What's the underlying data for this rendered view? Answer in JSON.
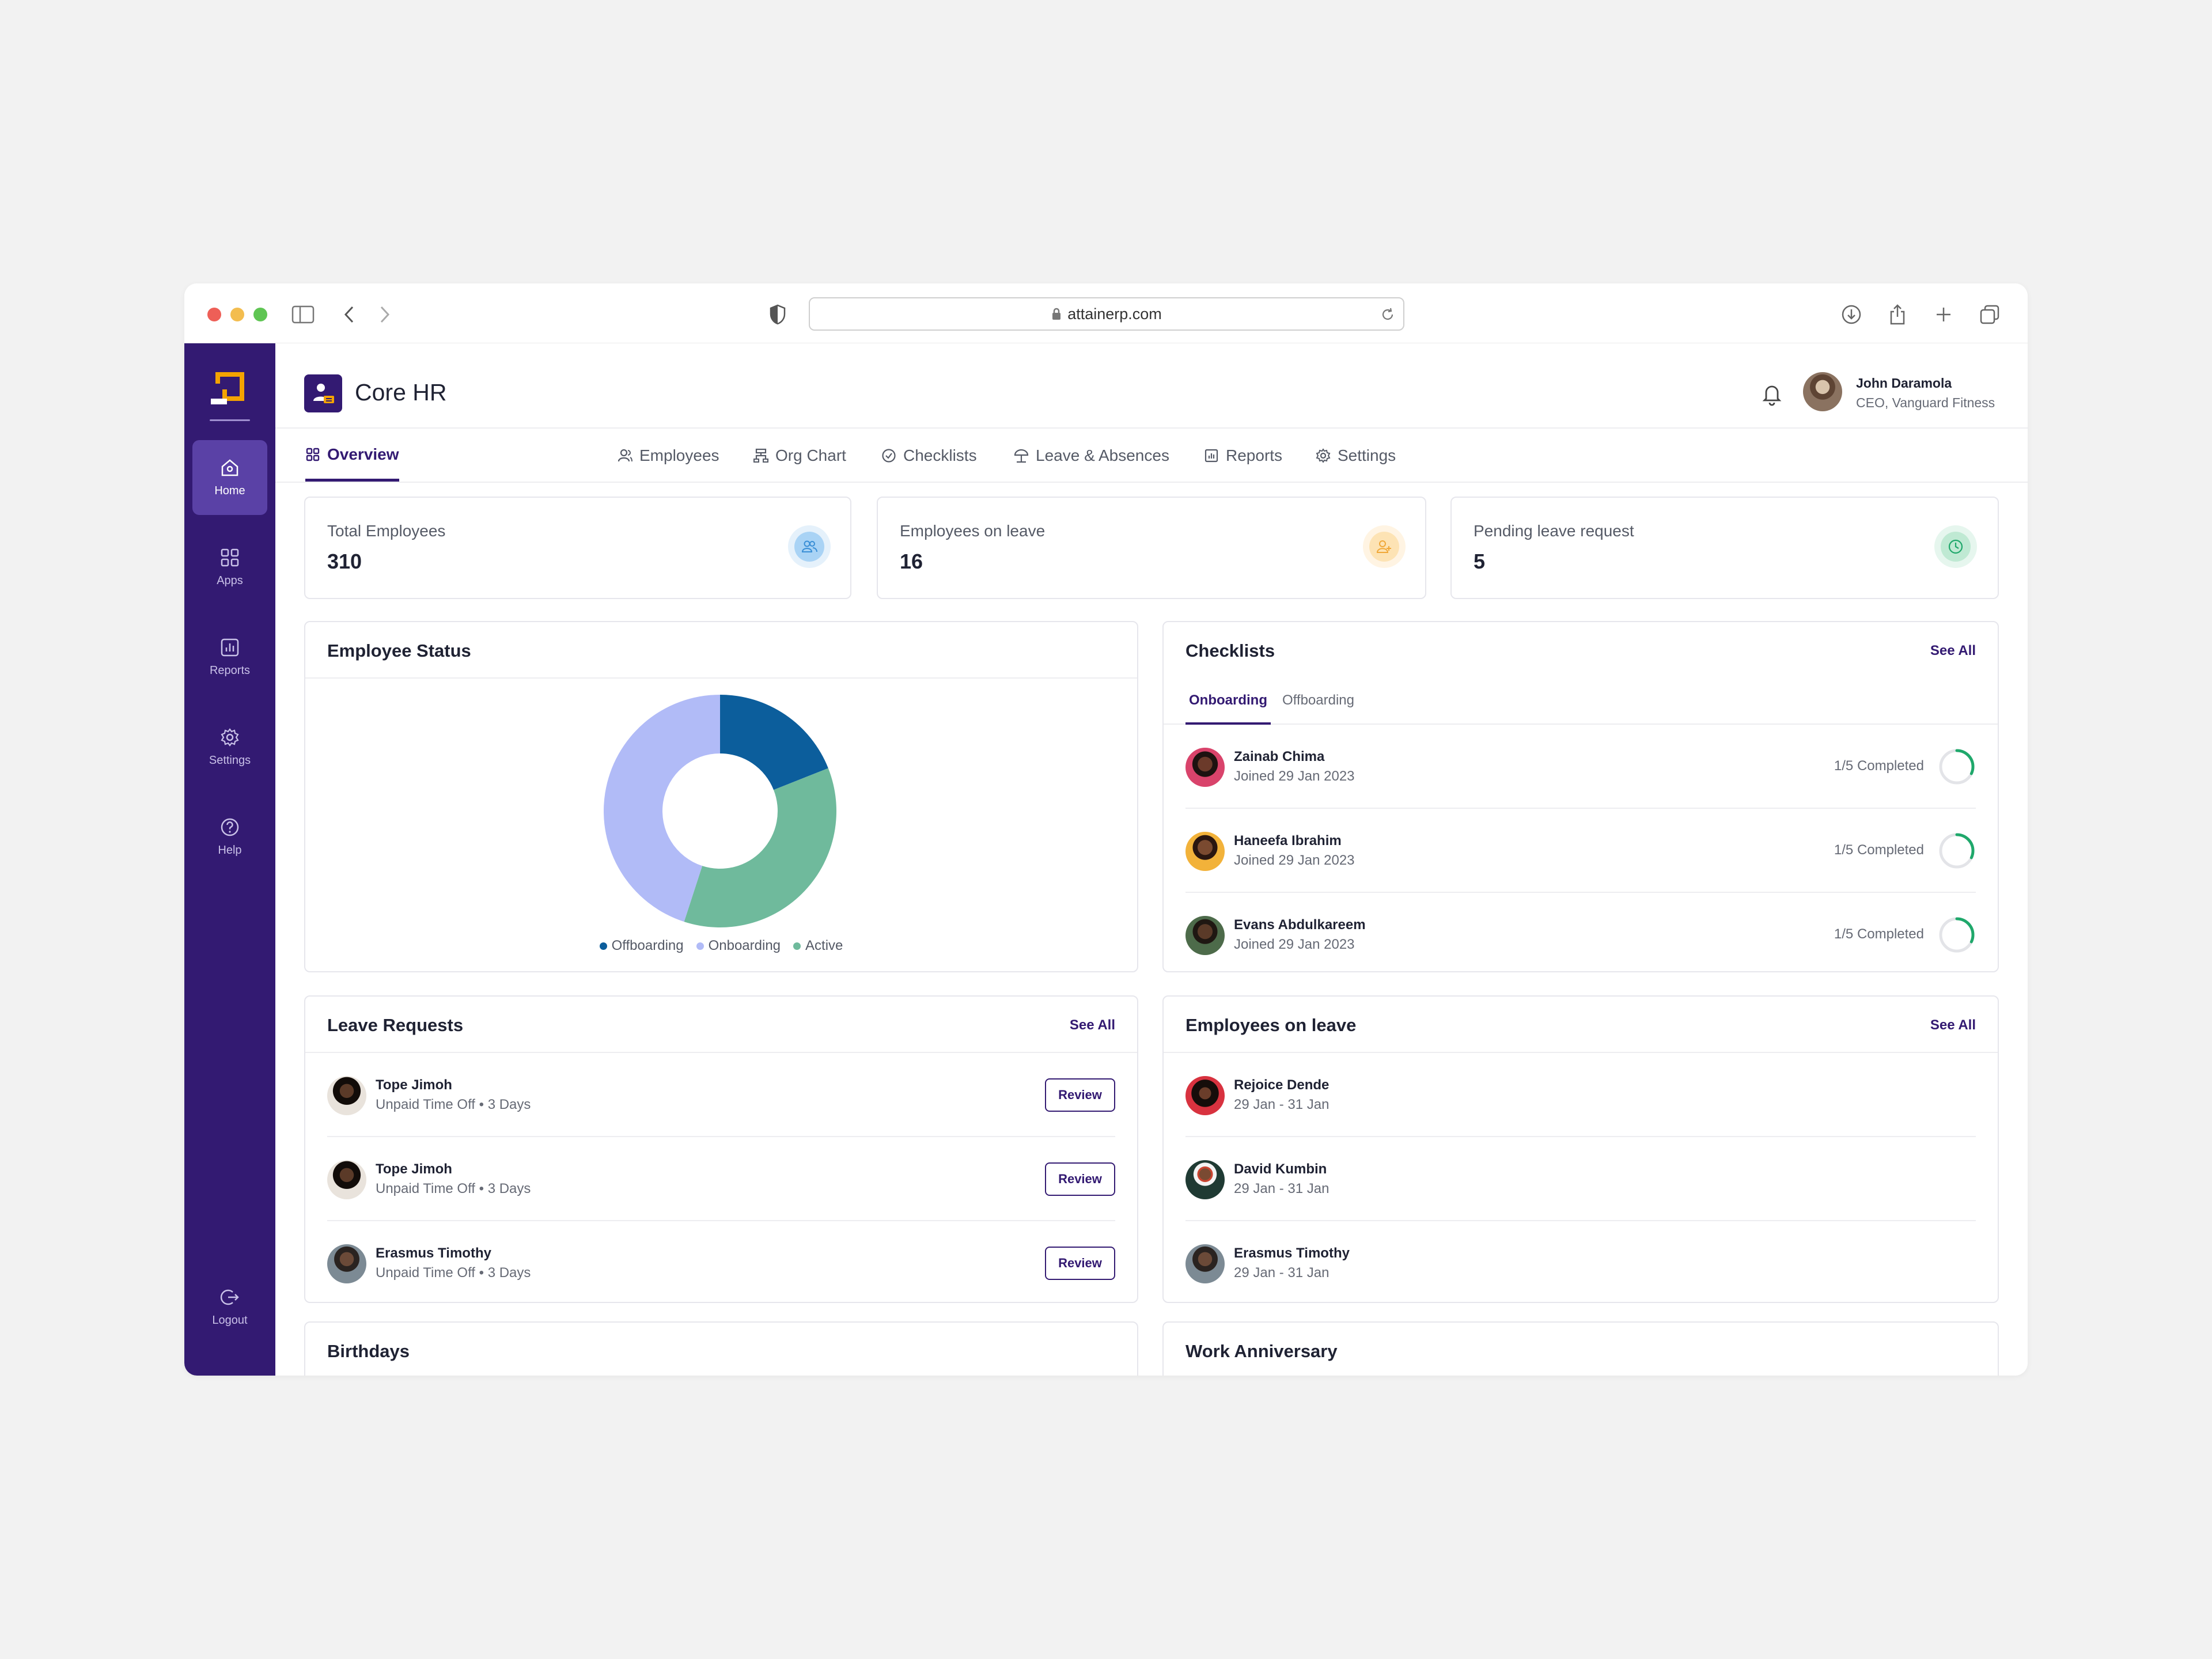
{
  "browser": {
    "url": "attainerp.com",
    "traffic_lights": [
      "#ee5f57",
      "#f3bd4f",
      "#5fc553"
    ]
  },
  "sidebar": {
    "items": [
      {
        "label": "Home",
        "icon": "home-icon"
      },
      {
        "label": "Apps",
        "icon": "apps-icon"
      },
      {
        "label": "Reports",
        "icon": "reports-icon"
      },
      {
        "label": "Settings",
        "icon": "settings-icon"
      },
      {
        "label": "Help",
        "icon": "help-icon"
      }
    ],
    "logout": {
      "label": "Logout",
      "icon": "logout-icon"
    }
  },
  "header": {
    "title": "Core HR",
    "user": {
      "name": "John Daramola",
      "role": "CEO, Vanguard Fitness"
    }
  },
  "tabs": [
    {
      "label": "Overview",
      "icon": "grid-icon"
    },
    {
      "label": "Employees",
      "icon": "person-icon"
    },
    {
      "label": "Org Chart",
      "icon": "org-chart-icon"
    },
    {
      "label": "Checklists",
      "icon": "check-circle-icon"
    },
    {
      "label": "Leave & Absences",
      "icon": "umbrella-icon"
    },
    {
      "label": "Reports",
      "icon": "report-icon"
    },
    {
      "label": "Settings",
      "icon": "gear-icon"
    }
  ],
  "stats": [
    {
      "label": "Total Employees",
      "value": "310",
      "icon": "people-icon"
    },
    {
      "label": "Employees on leave",
      "value": "16",
      "icon": "person-away-icon"
    },
    {
      "label": "Pending leave request",
      "value": "5",
      "icon": "clock-icon"
    }
  ],
  "employee_status": {
    "title": "Employee Status",
    "legend": [
      "Offboarding",
      "Onboarding",
      "Active"
    ]
  },
  "chart_data": {
    "type": "pie",
    "title": "Employee Status",
    "categories": [
      "Offboarding",
      "Active",
      "Onboarding"
    ],
    "values": [
      19,
      36,
      45
    ],
    "colors": [
      "#0c5e9c",
      "#6fba9c",
      "#b1bbf7"
    ],
    "donut": true,
    "legend_position": "bottom"
  },
  "checklists": {
    "title": "Checklists",
    "see_all": "See All",
    "subtabs": [
      "Onboarding",
      "Offboarding"
    ],
    "items": [
      {
        "name": "Zainab Chima",
        "joined": "Joined 29 Jan 2023",
        "status": "1/5 Completed",
        "progress": 0.2
      },
      {
        "name": "Haneefa Ibrahim",
        "joined": "Joined 29 Jan 2023",
        "status": "1/5 Completed",
        "progress": 0.2
      },
      {
        "name": "Evans Abdulkareem",
        "joined": "Joined 29 Jan 2023",
        "status": "1/5 Completed",
        "progress": 0.2
      }
    ]
  },
  "leave_requests": {
    "title": "Leave Requests",
    "see_all": "See All",
    "review_label": "Review",
    "items": [
      {
        "name": "Tope Jimoh",
        "detail": "Unpaid Time Off • 3 Days"
      },
      {
        "name": "Tope Jimoh",
        "detail": "Unpaid Time Off • 3 Days"
      },
      {
        "name": "Erasmus Timothy",
        "detail": "Unpaid Time Off • 3 Days"
      }
    ]
  },
  "employees_on_leave": {
    "title": "Employees on leave",
    "see_all": "See All",
    "items": [
      {
        "name": "Rejoice Dende",
        "dates": "29 Jan - 31 Jan"
      },
      {
        "name": "David Kumbin",
        "dates": "29 Jan - 31 Jan"
      },
      {
        "name": "Erasmus Timothy",
        "dates": "29 Jan - 31 Jan"
      }
    ]
  },
  "birthdays": {
    "title": "Birthdays"
  },
  "work_anniversary": {
    "title": "Work Anniversary"
  },
  "colors": {
    "sidebar": "#331a72",
    "accent": "#331a72",
    "progress": "#1fa86b",
    "brand_logo": "#f4a300"
  }
}
